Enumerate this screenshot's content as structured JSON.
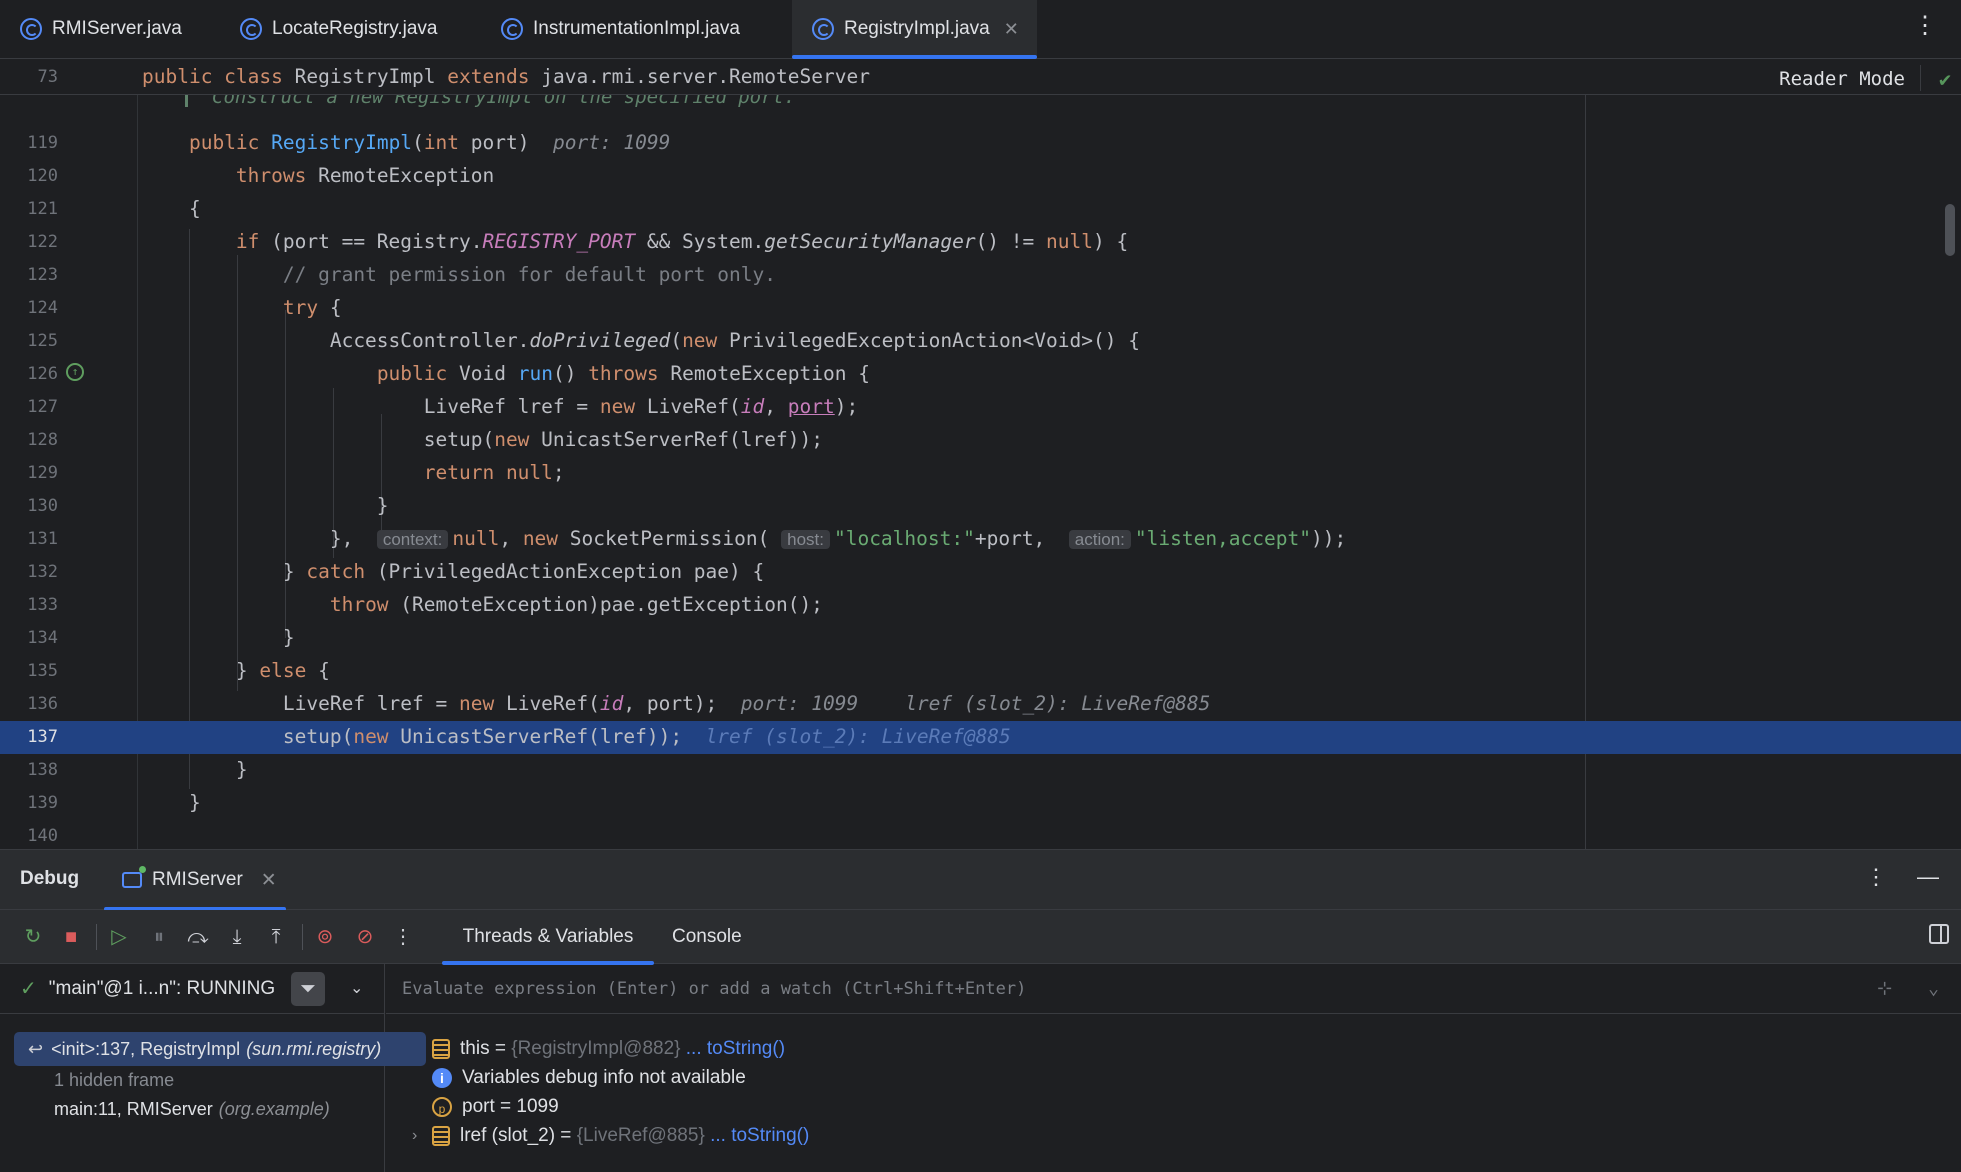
{
  "tabs": [
    {
      "label": "RMIServer.java",
      "active": false
    },
    {
      "label": "LocateRegistry.java",
      "active": false
    },
    {
      "label": "InstrumentationImpl.java",
      "active": false
    },
    {
      "label": "RegistryImpl.java",
      "active": true
    }
  ],
  "editor": {
    "sticky_line": {
      "num": "73",
      "kw1": "public class",
      "name": "RegistryImpl",
      "kw2": "extends",
      "super": "java.rmi.server.RemoteServer"
    },
    "faded_comment": "Construct a new RegistryImpl on the specified port.",
    "reader_mode": "Reader Mode",
    "current_line": "137",
    "lines": [
      {
        "num": "119"
      },
      {
        "num": "120"
      },
      {
        "num": "121"
      },
      {
        "num": "122"
      },
      {
        "num": "123"
      },
      {
        "num": "124"
      },
      {
        "num": "125"
      },
      {
        "num": "126"
      },
      {
        "num": "127"
      },
      {
        "num": "128"
      },
      {
        "num": "129"
      },
      {
        "num": "130"
      },
      {
        "num": "131"
      },
      {
        "num": "132"
      },
      {
        "num": "133"
      },
      {
        "num": "134"
      },
      {
        "num": "135"
      },
      {
        "num": "136"
      },
      {
        "num": "137"
      },
      {
        "num": "138"
      },
      {
        "num": "139"
      },
      {
        "num": "140"
      }
    ],
    "hints": {
      "l119": "port: 1099",
      "l131_context": "context:",
      "l131_host": "host:",
      "l131_action": "action:",
      "l136": "port: 1099    lref (slot_2): LiveRef@885",
      "l137": "lref (slot_2): LiveRef@885"
    }
  },
  "debug": {
    "title": "Debug",
    "session_tab": "RMIServer",
    "view_tabs": [
      "Threads & Variables",
      "Console"
    ],
    "thread": "\"main\"@1 i...n\": RUNNING",
    "eval_placeholder": "Evaluate expression (Enter) or add a watch (Ctrl+Shift+Enter)",
    "frames": [
      {
        "method": "<init>:137, RegistryImpl",
        "pkg": "(sun.rmi.registry)",
        "selected": true
      },
      {
        "method": "1 hidden frame",
        "pkg": "",
        "selected": false
      },
      {
        "method": "main:11, RMIServer",
        "pkg": "(org.example)",
        "selected": false
      }
    ],
    "variables": [
      {
        "icon": "field-icon",
        "name": "this",
        "eq": " = ",
        "value": "{RegistryImpl@882}",
        "link": " ... toString()"
      },
      {
        "icon": "info-icon",
        "name": "Variables debug info not available",
        "eq": "",
        "value": "",
        "link": ""
      },
      {
        "icon": "parameter-icon",
        "name": "port",
        "eq": " = ",
        "value": "1099",
        "link": ""
      },
      {
        "icon": "field-icon",
        "name": "lref (slot_2)",
        "eq": " = ",
        "value": "{LiveRef@885}",
        "link": " ... toString()"
      }
    ]
  },
  "colors": {
    "accent": "#3574f0",
    "selection": "#214283",
    "keyword": "#cf8e6d",
    "string": "#6aab73",
    "function": "#56a8f5"
  }
}
